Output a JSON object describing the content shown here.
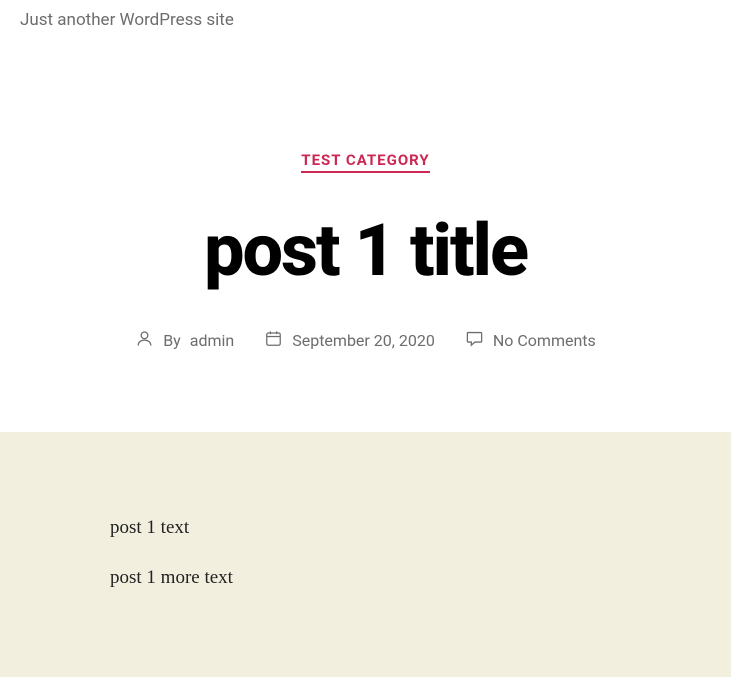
{
  "site": {
    "tagline": "Just another WordPress site"
  },
  "post": {
    "category": "TEST CATEGORY",
    "title": "post 1 title",
    "author_by": "By",
    "author": "admin",
    "date": "September 20, 2020",
    "comments": "No Comments",
    "paragraphs": [
      "post 1 text",
      "post 1 more text"
    ]
  }
}
